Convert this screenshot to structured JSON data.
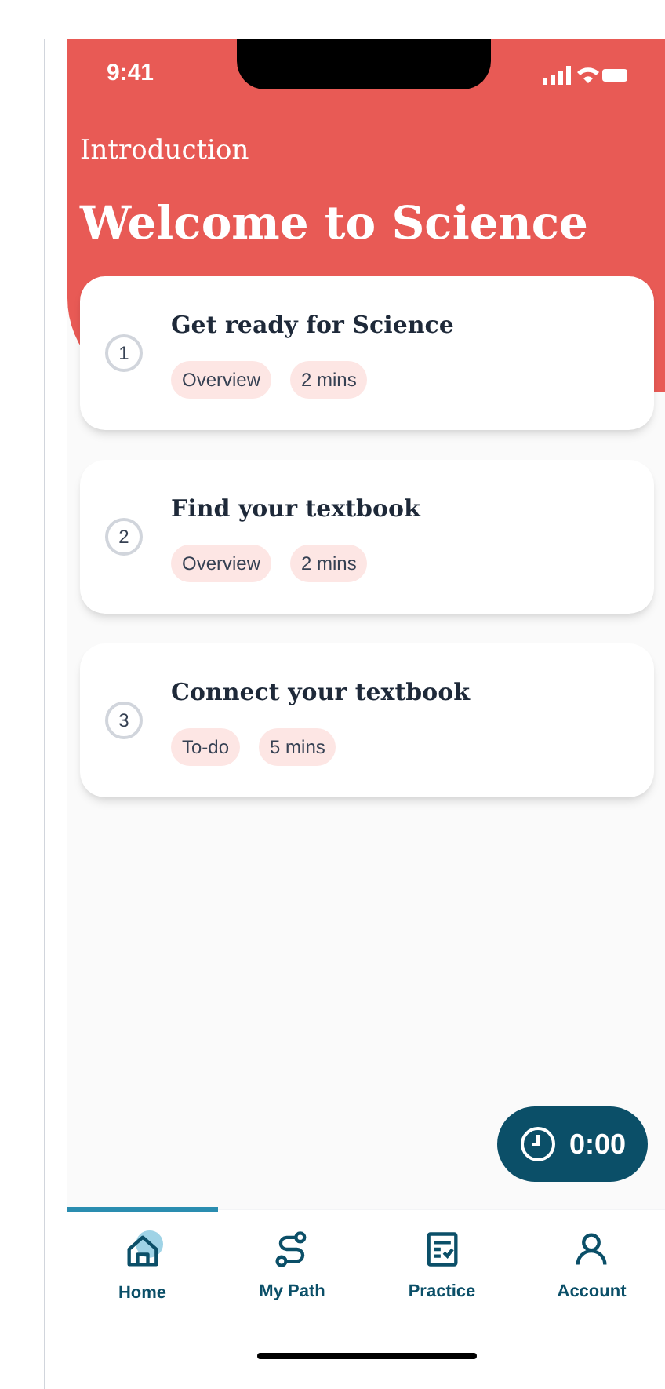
{
  "status_bar": {
    "time": "9:41"
  },
  "header": {
    "subtitle": "Introduction",
    "title": "Welcome to Science"
  },
  "lessons": [
    {
      "number": "1",
      "title": "Get ready for Science",
      "tags": [
        "Overview",
        "2 mins"
      ]
    },
    {
      "number": "2",
      "title": "Find your textbook",
      "tags": [
        "Overview",
        "2 mins"
      ]
    },
    {
      "number": "3",
      "title": "Connect your textbook",
      "tags": [
        "To-do",
        "5 mins"
      ]
    }
  ],
  "timer": {
    "label": "0:00"
  },
  "nav": [
    {
      "kind": "home",
      "label": "Home",
      "selected": true
    },
    {
      "kind": "path",
      "label": "My Path",
      "selected": false
    },
    {
      "kind": "practice",
      "label": "Practice",
      "selected": false
    },
    {
      "kind": "account",
      "label": "Account",
      "selected": false
    }
  ]
}
